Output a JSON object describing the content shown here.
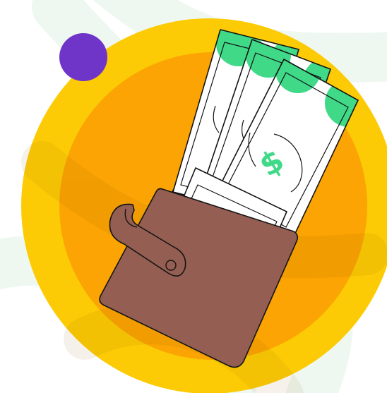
{
  "illustration": {
    "subject": "wallet-with-money",
    "banknote_symbol": "$"
  },
  "colors": {
    "background": "#ffffff",
    "background_waves": "#eef8f1",
    "outer_circle": "#fccb05",
    "inner_circle": "#fba403",
    "accent_dot": "#6e35c8",
    "wallet": "#945e52",
    "banknote": "#ffffff",
    "banknote_accent": "#3fd988",
    "outline": "#141414"
  },
  "icons": [
    "wallet-icon",
    "banknote-icon",
    "dollar-sign-icon"
  ]
}
